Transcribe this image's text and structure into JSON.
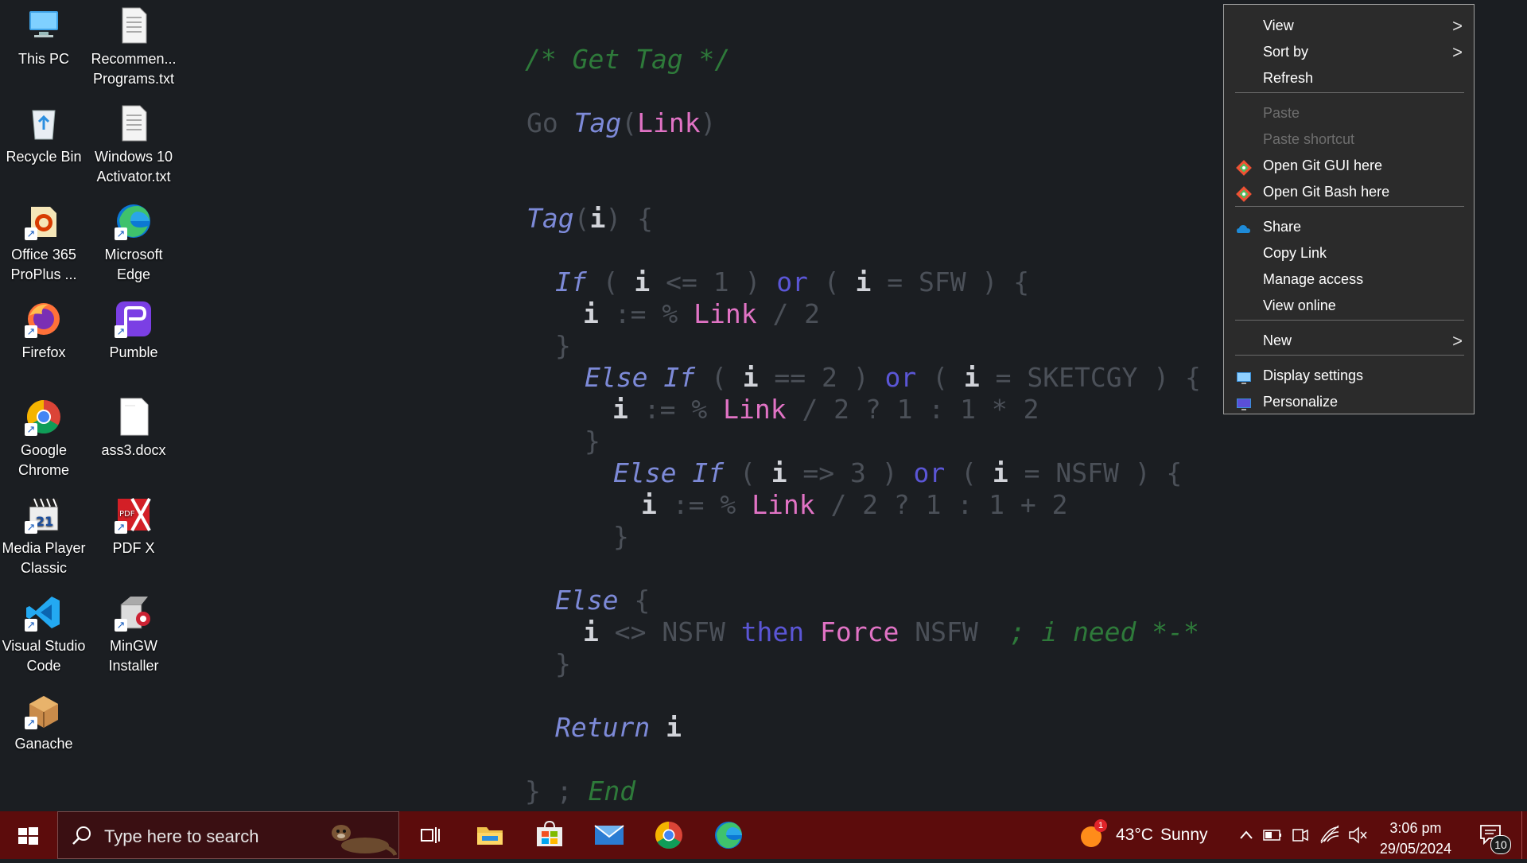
{
  "wallpaper": {
    "comment1": "/* Get Tag */",
    "go": "Go ",
    "tag": "Tag",
    "lp": "(",
    "link": "Link",
    "rp": ")",
    "i": "i",
    "brace_open": " {",
    "if": "If",
    "else_if": "Else If",
    "else": "Else",
    "or": "or",
    "line_if_a": " ( ",
    "line_if_b": " <= 1 ) ",
    "line_if_c": " ( ",
    "line_if_d": " = SFW ) {",
    "assign1_a": " := % ",
    "assign1_b": " / 2",
    "close": "}",
    "elseif1_b": " == 2 ) ",
    "elseif1_d": " = SKETCGY ) {",
    "assign2_b": " / 2 ? 1 : 1 * 2",
    "elseif2_b": " => 3 ) ",
    "elseif2_d": " = NSFW ) {",
    "assign3_b": " / 2 ? 1 : 1 + 2",
    "else_brace": " {",
    "else_line_a": " <> NSFW ",
    "then": "then",
    "force": "Force",
    "else_line_b": " NSFW  ",
    "comment2": "; i need *-*",
    "return": "Return",
    "end_a": "} ; ",
    "end_b": "End"
  },
  "desktop_icons": [
    {
      "label": "This PC",
      "icon": "this-pc-icon"
    },
    {
      "label": "Recommen... Programs.txt",
      "icon": "text-file-icon"
    },
    {
      "label": "Recycle Bin",
      "icon": "recycle-bin-icon"
    },
    {
      "label": "Windows 10 Activator.txt",
      "icon": "text-file-icon"
    },
    {
      "label": "Office 365 ProPlus ...",
      "icon": "office-icon"
    },
    {
      "label": "Microsoft Edge",
      "icon": "edge-icon"
    },
    {
      "label": "Firefox",
      "icon": "firefox-icon"
    },
    {
      "label": "Pumble",
      "icon": "pumble-icon"
    },
    {
      "label": "Google Chrome",
      "icon": "chrome-icon"
    },
    {
      "label": "ass3.docx",
      "icon": "docx-file-icon"
    },
    {
      "label": "Media Player Classic",
      "icon": "media-player-icon"
    },
    {
      "label": "PDF X",
      "icon": "pdf-icon"
    },
    {
      "label": "Visual Studio Code",
      "icon": "vscode-icon"
    },
    {
      "label": "MinGW Installer",
      "icon": "mingw-icon"
    },
    {
      "label": "Ganache",
      "icon": "ganache-icon"
    }
  ],
  "context_menu": {
    "view": "View",
    "sort_by": "Sort by",
    "refresh": "Refresh",
    "paste": "Paste",
    "paste_shortcut": "Paste shortcut",
    "git_gui": "Open Git GUI here",
    "git_bash": "Open Git Bash here",
    "share": "Share",
    "copy_link": "Copy Link",
    "manage_access": "Manage access",
    "view_online": "View online",
    "new": "New",
    "display_settings": "Display settings",
    "personalize": "Personalize",
    "submenu_arrow": ">"
  },
  "taskbar": {
    "search_placeholder": "Type here to search",
    "weather_temp": "43°C",
    "weather_cond": "Sunny",
    "weather_badge": "1",
    "time": "3:06 pm",
    "date": "29/05/2024",
    "notification_count": "10"
  },
  "colors": {
    "taskbar": "#5c0c0c",
    "menu_bg": "#2b2b2b",
    "wallpaper": "#1b1e22"
  }
}
